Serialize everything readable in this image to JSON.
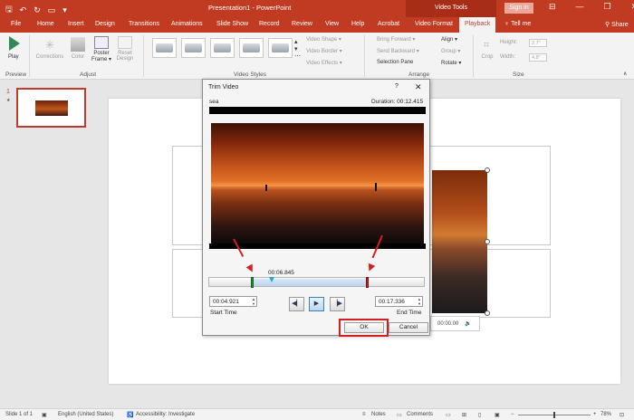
{
  "titlebar": {
    "document_title": "Presentation1 - PowerPoint",
    "tools_title": "Video Tools",
    "signin": "Sign in",
    "minimize": "—",
    "restore": "❐",
    "close": "✕"
  },
  "tabs": {
    "items": [
      "File",
      "Home",
      "Insert",
      "Design",
      "Transitions",
      "Animations",
      "Slide Show",
      "Record",
      "Review",
      "View",
      "Help",
      "Acrobat",
      "Video Format",
      "Playback"
    ],
    "active": "Playback",
    "tell_me": "Tell me",
    "share": "Share"
  },
  "ribbon": {
    "play_label": "Play",
    "preview_group": "Preview",
    "corrections": "Corrections",
    "color": "Color",
    "poster_frame": "Poster Frame ▾",
    "reset_design": "Reset Design",
    "adjust_group": "Adjust",
    "video_styles_group": "Video Styles",
    "video_shape": "Video Shape ▾",
    "video_border": "Video Border ▾",
    "video_effects": "Video Effects ▾",
    "bring_forward": "Bring Forward ▾",
    "send_backward": "Send Backward ▾",
    "selection_pane": "Selection Pane",
    "align": "Align ▾",
    "group": "Group ▾",
    "rotate": "Rotate ▾",
    "arrange_group": "Arrange",
    "crop": "Crop",
    "height_label": "Height:",
    "width_label": "Width:",
    "height_value": "2.7\"",
    "width_value": "4.8\"",
    "size_group": "Size"
  },
  "thumbnails": {
    "slide_number": "1",
    "star": "★"
  },
  "slide": {
    "video_control_time": "00:00.00"
  },
  "dialog": {
    "title": "Trim Video",
    "help": "?",
    "close": "✕",
    "video_name": "sea",
    "duration": "Duration: 00:12.415",
    "current_time": "00:06.845",
    "start_time_value": "00:04.921",
    "end_time_value": "00:17.336",
    "start_time_label": "Start Time",
    "end_time_label": "End Time",
    "prev_frame": "◀▏",
    "play": "▶",
    "next_frame": "▕▶",
    "ok": "OK",
    "cancel": "Cancel"
  },
  "statusbar": {
    "slide_info": "Slide 1 of 1",
    "language": "English (United States)",
    "accessibility": "Accessibility: Investigate",
    "notes": "Notes",
    "comments": "Comments",
    "zoom": "78%"
  }
}
